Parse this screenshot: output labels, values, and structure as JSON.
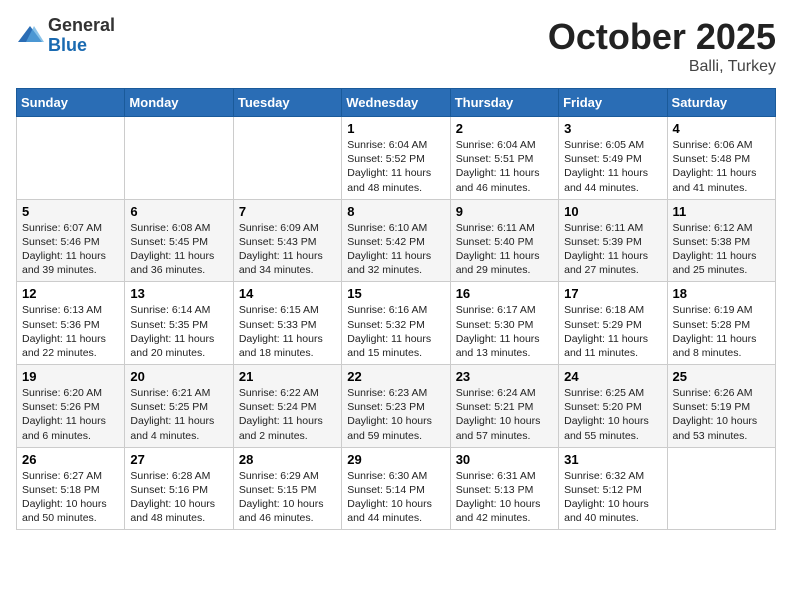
{
  "header": {
    "logo_general": "General",
    "logo_blue": "Blue",
    "month": "October 2025",
    "location": "Balli, Turkey"
  },
  "days_of_week": [
    "Sunday",
    "Monday",
    "Tuesday",
    "Wednesday",
    "Thursday",
    "Friday",
    "Saturday"
  ],
  "weeks": [
    [
      {
        "day": "",
        "info": ""
      },
      {
        "day": "",
        "info": ""
      },
      {
        "day": "",
        "info": ""
      },
      {
        "day": "1",
        "info": "Sunrise: 6:04 AM\nSunset: 5:52 PM\nDaylight: 11 hours\nand 48 minutes."
      },
      {
        "day": "2",
        "info": "Sunrise: 6:04 AM\nSunset: 5:51 PM\nDaylight: 11 hours\nand 46 minutes."
      },
      {
        "day": "3",
        "info": "Sunrise: 6:05 AM\nSunset: 5:49 PM\nDaylight: 11 hours\nand 44 minutes."
      },
      {
        "day": "4",
        "info": "Sunrise: 6:06 AM\nSunset: 5:48 PM\nDaylight: 11 hours\nand 41 minutes."
      }
    ],
    [
      {
        "day": "5",
        "info": "Sunrise: 6:07 AM\nSunset: 5:46 PM\nDaylight: 11 hours\nand 39 minutes."
      },
      {
        "day": "6",
        "info": "Sunrise: 6:08 AM\nSunset: 5:45 PM\nDaylight: 11 hours\nand 36 minutes."
      },
      {
        "day": "7",
        "info": "Sunrise: 6:09 AM\nSunset: 5:43 PM\nDaylight: 11 hours\nand 34 minutes."
      },
      {
        "day": "8",
        "info": "Sunrise: 6:10 AM\nSunset: 5:42 PM\nDaylight: 11 hours\nand 32 minutes."
      },
      {
        "day": "9",
        "info": "Sunrise: 6:11 AM\nSunset: 5:40 PM\nDaylight: 11 hours\nand 29 minutes."
      },
      {
        "day": "10",
        "info": "Sunrise: 6:11 AM\nSunset: 5:39 PM\nDaylight: 11 hours\nand 27 minutes."
      },
      {
        "day": "11",
        "info": "Sunrise: 6:12 AM\nSunset: 5:38 PM\nDaylight: 11 hours\nand 25 minutes."
      }
    ],
    [
      {
        "day": "12",
        "info": "Sunrise: 6:13 AM\nSunset: 5:36 PM\nDaylight: 11 hours\nand 22 minutes."
      },
      {
        "day": "13",
        "info": "Sunrise: 6:14 AM\nSunset: 5:35 PM\nDaylight: 11 hours\nand 20 minutes."
      },
      {
        "day": "14",
        "info": "Sunrise: 6:15 AM\nSunset: 5:33 PM\nDaylight: 11 hours\nand 18 minutes."
      },
      {
        "day": "15",
        "info": "Sunrise: 6:16 AM\nSunset: 5:32 PM\nDaylight: 11 hours\nand 15 minutes."
      },
      {
        "day": "16",
        "info": "Sunrise: 6:17 AM\nSunset: 5:30 PM\nDaylight: 11 hours\nand 13 minutes."
      },
      {
        "day": "17",
        "info": "Sunrise: 6:18 AM\nSunset: 5:29 PM\nDaylight: 11 hours\nand 11 minutes."
      },
      {
        "day": "18",
        "info": "Sunrise: 6:19 AM\nSunset: 5:28 PM\nDaylight: 11 hours\nand 8 minutes."
      }
    ],
    [
      {
        "day": "19",
        "info": "Sunrise: 6:20 AM\nSunset: 5:26 PM\nDaylight: 11 hours\nand 6 minutes."
      },
      {
        "day": "20",
        "info": "Sunrise: 6:21 AM\nSunset: 5:25 PM\nDaylight: 11 hours\nand 4 minutes."
      },
      {
        "day": "21",
        "info": "Sunrise: 6:22 AM\nSunset: 5:24 PM\nDaylight: 11 hours\nand 2 minutes."
      },
      {
        "day": "22",
        "info": "Sunrise: 6:23 AM\nSunset: 5:23 PM\nDaylight: 10 hours\nand 59 minutes."
      },
      {
        "day": "23",
        "info": "Sunrise: 6:24 AM\nSunset: 5:21 PM\nDaylight: 10 hours\nand 57 minutes."
      },
      {
        "day": "24",
        "info": "Sunrise: 6:25 AM\nSunset: 5:20 PM\nDaylight: 10 hours\nand 55 minutes."
      },
      {
        "day": "25",
        "info": "Sunrise: 6:26 AM\nSunset: 5:19 PM\nDaylight: 10 hours\nand 53 minutes."
      }
    ],
    [
      {
        "day": "26",
        "info": "Sunrise: 6:27 AM\nSunset: 5:18 PM\nDaylight: 10 hours\nand 50 minutes."
      },
      {
        "day": "27",
        "info": "Sunrise: 6:28 AM\nSunset: 5:16 PM\nDaylight: 10 hours\nand 48 minutes."
      },
      {
        "day": "28",
        "info": "Sunrise: 6:29 AM\nSunset: 5:15 PM\nDaylight: 10 hours\nand 46 minutes."
      },
      {
        "day": "29",
        "info": "Sunrise: 6:30 AM\nSunset: 5:14 PM\nDaylight: 10 hours\nand 44 minutes."
      },
      {
        "day": "30",
        "info": "Sunrise: 6:31 AM\nSunset: 5:13 PM\nDaylight: 10 hours\nand 42 minutes."
      },
      {
        "day": "31",
        "info": "Sunrise: 6:32 AM\nSunset: 5:12 PM\nDaylight: 10 hours\nand 40 minutes."
      },
      {
        "day": "",
        "info": ""
      }
    ]
  ]
}
